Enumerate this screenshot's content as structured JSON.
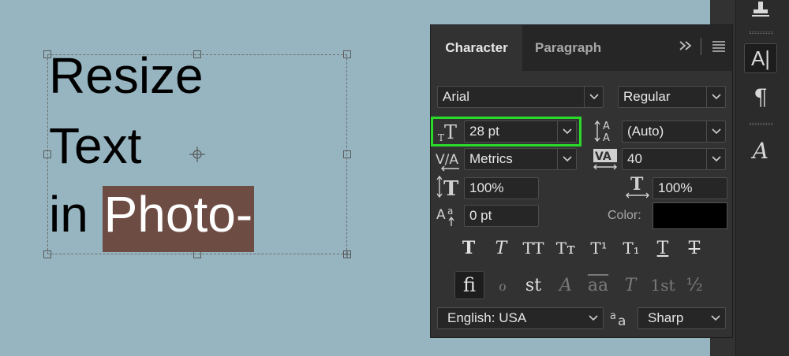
{
  "canvas": {
    "lines": [
      "Resize",
      "Text",
      "in "
    ],
    "highlighted_word": "Photo-"
  },
  "panel": {
    "tabs": [
      {
        "label": "Character",
        "active": true
      },
      {
        "label": "Paragraph",
        "active": false
      }
    ],
    "font_family": "Arial",
    "font_style": "Regular",
    "font_size": "28 pt",
    "leading": "(Auto)",
    "kerning": "Metrics",
    "tracking": "40",
    "vertical_scale": "100%",
    "horizontal_scale": "100%",
    "baseline_shift": "0 pt",
    "color_label": "Color:",
    "color_value": "#000000",
    "language": "English: USA",
    "anti_alias": "Sharp",
    "type_styles": [
      "T",
      "T",
      "TT",
      "Tт",
      "T¹",
      "T₁",
      "T",
      "T"
    ],
    "opentype": [
      "fi",
      "ℴ",
      "st",
      "A",
      "aa",
      "T",
      "1st",
      "½"
    ]
  },
  "strip": {
    "character_icon": "A|",
    "paragraph_icon": "¶",
    "glyphs_icon": "A"
  },
  "colors": {
    "canvas_bg": "#96b5c0",
    "highlight_bg": "#6d4c44",
    "panel_bg": "#323232",
    "focus_outline": "#2adb2a"
  }
}
